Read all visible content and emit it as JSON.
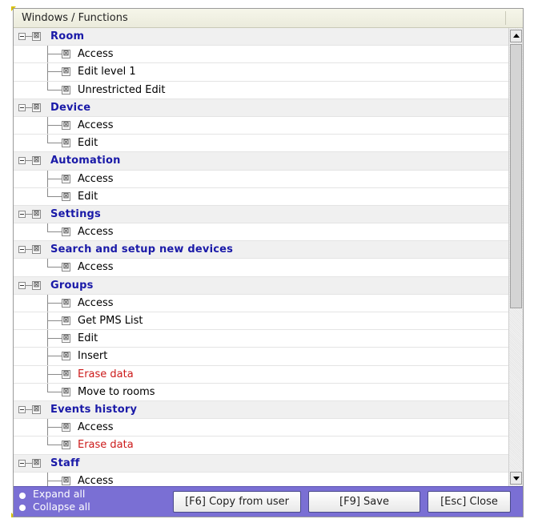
{
  "header": {
    "title": "Windows / Functions"
  },
  "tree": [
    {
      "type": "group",
      "label": "Room"
    },
    {
      "type": "child",
      "label": "Access",
      "last": false,
      "danger": false
    },
    {
      "type": "child",
      "label": "Edit level 1",
      "last": false,
      "danger": false
    },
    {
      "type": "child",
      "label": "Unrestricted Edit",
      "last": true,
      "danger": false
    },
    {
      "type": "group",
      "label": "Device"
    },
    {
      "type": "child",
      "label": "Access",
      "last": false,
      "danger": false
    },
    {
      "type": "child",
      "label": "Edit",
      "last": true,
      "danger": false
    },
    {
      "type": "group",
      "label": "Automation"
    },
    {
      "type": "child",
      "label": "Access",
      "last": false,
      "danger": false
    },
    {
      "type": "child",
      "label": "Edit",
      "last": true,
      "danger": false
    },
    {
      "type": "group",
      "label": "Settings"
    },
    {
      "type": "child",
      "label": "Access",
      "last": true,
      "danger": false
    },
    {
      "type": "group",
      "label": "Search and setup new devices"
    },
    {
      "type": "child",
      "label": "Access",
      "last": true,
      "danger": false
    },
    {
      "type": "group",
      "label": "Groups"
    },
    {
      "type": "child",
      "label": "Access",
      "last": false,
      "danger": false
    },
    {
      "type": "child",
      "label": "Get PMS List",
      "last": false,
      "danger": false
    },
    {
      "type": "child",
      "label": "Edit",
      "last": false,
      "danger": false
    },
    {
      "type": "child",
      "label": "Insert",
      "last": false,
      "danger": false
    },
    {
      "type": "child",
      "label": "Erase data",
      "last": false,
      "danger": true
    },
    {
      "type": "child",
      "label": "Move to rooms",
      "last": true,
      "danger": false
    },
    {
      "type": "group",
      "label": "Events history"
    },
    {
      "type": "child",
      "label": "Access",
      "last": false,
      "danger": false
    },
    {
      "type": "child",
      "label": "Erase data",
      "last": true,
      "danger": true
    },
    {
      "type": "group",
      "label": "Staff"
    },
    {
      "type": "child",
      "label": "Access",
      "last": false,
      "danger": false
    }
  ],
  "checkbox_mark": "⊠",
  "footer": {
    "expand_all": "Expand all",
    "collapse_all": "Collapse all",
    "copy_button": "[F6] Copy from user",
    "save_button": "[F9] Save",
    "close_button": "[Esc] Close"
  },
  "colors": {
    "group_text": "#1a1aa8",
    "danger_text": "#cc1a1a",
    "footer_bg": "#7a6fd4",
    "corner_accent": "#d8c000"
  }
}
